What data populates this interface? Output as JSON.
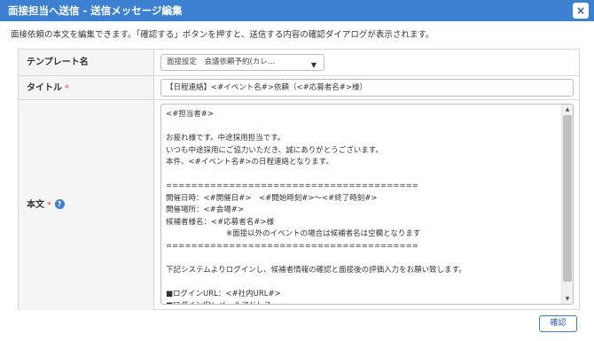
{
  "dialog": {
    "title": "面接担当へ送信 - 送信メッセージ編集",
    "close_label": "×",
    "description": "面接依頼の本文を編集できます。「確認する」ボタンを押すと、送信する内容の確認ダイアログが表示されます。",
    "confirm_label": "確認"
  },
  "form": {
    "template": {
      "label": "テンプレート名",
      "selected": "面接設定　会議依頼予約(カレ…",
      "arrow": "▼"
    },
    "title": {
      "label": "タイトル",
      "required_mark": "*",
      "value": "【日程連絡】<#イベント名#>依頼（<#応募者名#>様）"
    },
    "body": {
      "label": "本文",
      "required_mark": "*",
      "help": "?",
      "lines": [
        "<#担当者#>",
        "",
        "お疲れ様です。中途採用担当です。",
        "いつも中途採用にご協力いただき、誠にありがとうございます。",
        "本件、<#イベント名#>の日程連絡となります。",
        "",
        "========================================",
        "開催日時：<#開催日#>　<#開始時刻#>～<#終了時刻#>",
        "開催場所：<#会場#>",
        "候補者様名：<#応募者名#>様",
        "　　　　　　　　※面接以外のイベントの場合は候補者名は空欄となります",
        "========================================",
        "",
        "下記システムよりログインし、候補者情報の確認と面接後の評価入力をお願い致します。",
        "",
        "■ログインURL：<#社内URL#>",
        "■ログインID：メールアドレス"
      ]
    },
    "scroll_up": "▲",
    "scroll_down": "▼"
  }
}
